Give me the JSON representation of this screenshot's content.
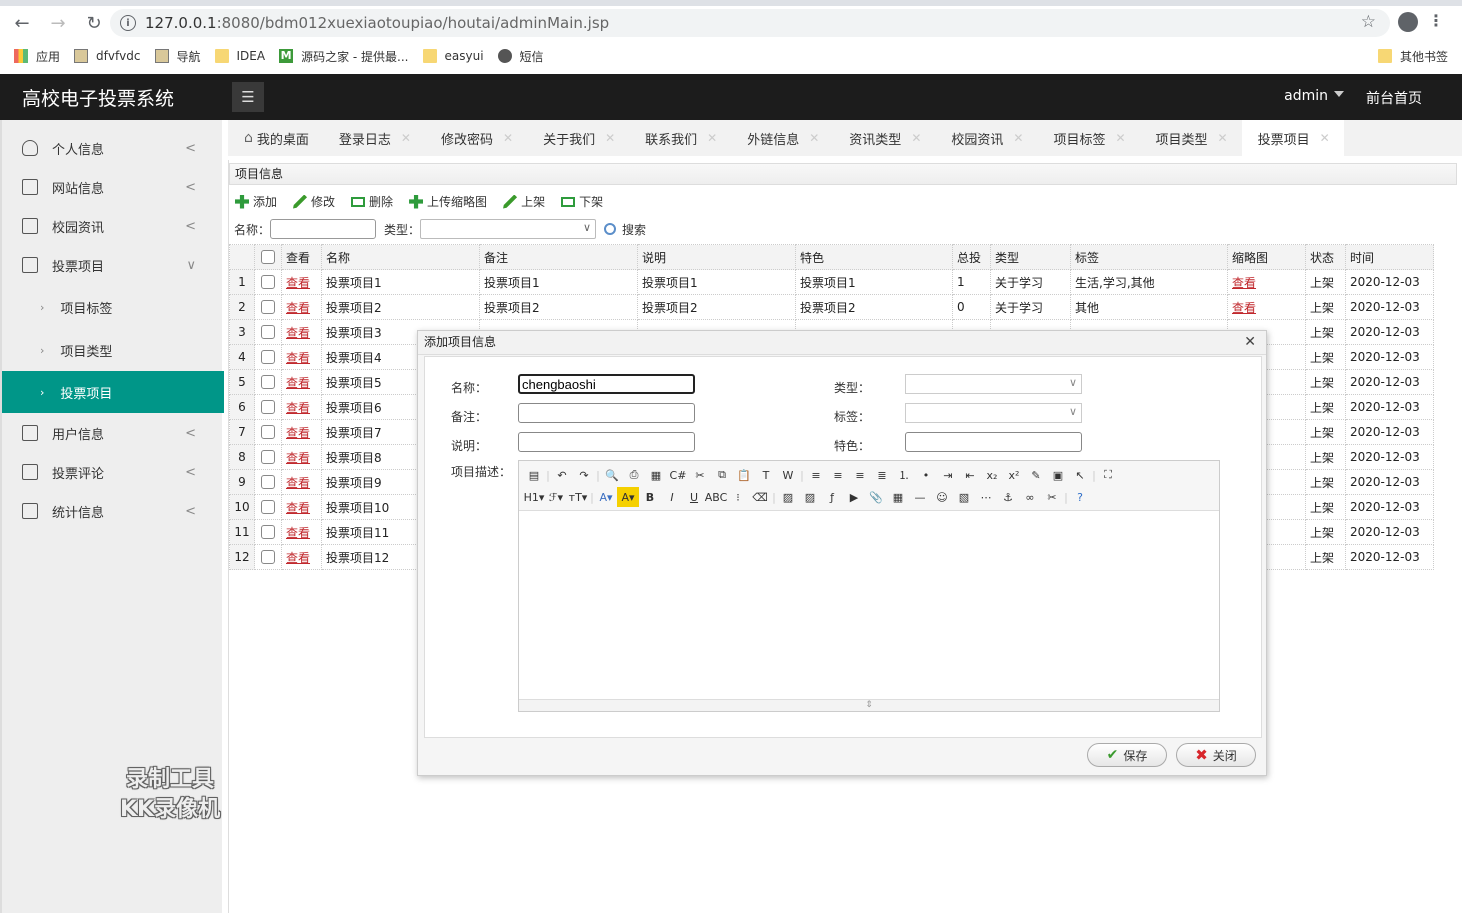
{
  "browser": {
    "url_host": "127.0.0.1",
    "url_rest": ":8080/bdm012xuexiaotoupiao/houtai/adminMain.jsp",
    "bookmarks": [
      {
        "label": "应用",
        "icon": "apps-grid-icon"
      },
      {
        "label": "dfvfvdc",
        "icon": "image-icon"
      },
      {
        "label": "导航",
        "icon": "image-icon"
      },
      {
        "label": "IDEA",
        "icon": "folder-icon"
      },
      {
        "label": "源码之家 - 提供最...",
        "icon": "m-logo-icon"
      },
      {
        "label": "easyui",
        "icon": "folder-icon"
      },
      {
        "label": "短信",
        "icon": "globe-icon"
      }
    ],
    "other_bookmarks": "其他书签"
  },
  "header": {
    "title": "高校电子投票系统",
    "user": "admin",
    "front_home": "前台首页"
  },
  "sidebar": {
    "items": [
      {
        "label": "个人信息",
        "icon": "user-icon",
        "arrow": "<"
      },
      {
        "label": "网站信息",
        "icon": "document-icon",
        "arrow": "<"
      },
      {
        "label": "校园资讯",
        "icon": "document-icon",
        "arrow": "<"
      },
      {
        "label": "投票项目",
        "icon": "document-icon",
        "arrow": "∨"
      },
      {
        "label": "用户信息",
        "icon": "document-icon",
        "arrow": "<"
      },
      {
        "label": "投票评论",
        "icon": "document-icon",
        "arrow": "<"
      },
      {
        "label": "统计信息",
        "icon": "document-icon",
        "arrow": "<"
      }
    ],
    "subitems": [
      {
        "label": "项目标签"
      },
      {
        "label": "项目类型"
      },
      {
        "label": "投票项目",
        "active": true
      }
    ]
  },
  "tabs": [
    {
      "label": "我的桌面",
      "closable": false
    },
    {
      "label": "登录日志",
      "closable": true
    },
    {
      "label": "修改密码",
      "closable": true
    },
    {
      "label": "关于我们",
      "closable": true
    },
    {
      "label": "联系我们",
      "closable": true
    },
    {
      "label": "外链信息",
      "closable": true
    },
    {
      "label": "资讯类型",
      "closable": true
    },
    {
      "label": "校园资讯",
      "closable": true
    },
    {
      "label": "项目标签",
      "closable": true
    },
    {
      "label": "项目类型",
      "closable": true
    },
    {
      "label": "投票项目",
      "closable": true,
      "active": true
    }
  ],
  "panel": {
    "title": "项目信息",
    "toolbar": {
      "add": "添加",
      "edit": "修改",
      "delete": "删除",
      "upload_thumb": "上传缩略图",
      "on_shelf": "上架",
      "off_shelf": "下架"
    },
    "search": {
      "name_label": "名称：",
      "name_value": "",
      "type_label": "类型：",
      "type_value": "",
      "button": "搜索"
    }
  },
  "table": {
    "columns": [
      "查看",
      "名称",
      "备注",
      "说明",
      "特色",
      "总投",
      "类型",
      "标签",
      "缩略图",
      "状态",
      "时间"
    ],
    "view_link": "查看",
    "rows": [
      {
        "n": "1",
        "name": "投票项目1",
        "remark": "投票项目1",
        "desc": "投票项目1",
        "feature": "投票项目1",
        "votes": "1",
        "type": "关于学习",
        "tags": "生活,学习,其他",
        "status": "上架",
        "time": "2020-12-03"
      },
      {
        "n": "2",
        "name": "投票项目2",
        "remark": "投票项目2",
        "desc": "投票项目2",
        "feature": "投票项目2",
        "votes": "0",
        "type": "关于学习",
        "tags": "其他",
        "status": "上架",
        "time": "2020-12-03"
      },
      {
        "n": "3",
        "name": "投票项目3",
        "status": "上架",
        "time": "2020-12-03"
      },
      {
        "n": "4",
        "name": "投票项目4",
        "status": "上架",
        "time": "2020-12-03"
      },
      {
        "n": "5",
        "name": "投票项目5",
        "status": "上架",
        "time": "2020-12-03"
      },
      {
        "n": "6",
        "name": "投票项目6",
        "status": "上架",
        "time": "2020-12-03"
      },
      {
        "n": "7",
        "name": "投票项目7",
        "status": "上架",
        "time": "2020-12-03"
      },
      {
        "n": "8",
        "name": "投票项目8",
        "status": "上架",
        "time": "2020-12-03"
      },
      {
        "n": "9",
        "name": "投票项目9",
        "status": "上架",
        "time": "2020-12-03"
      },
      {
        "n": "10",
        "name": "投票项目10",
        "status": "上架",
        "time": "2020-12-03"
      },
      {
        "n": "11",
        "name": "投票项目11",
        "status": "上架",
        "time": "2020-12-03"
      },
      {
        "n": "12",
        "name": "投票项目12",
        "status": "上架",
        "time": "2020-12-03"
      }
    ]
  },
  "dialog": {
    "title": "添加项目信息",
    "fields": {
      "name_label": "名称：",
      "name_value": "chengbaoshi",
      "remark_label": "备注：",
      "remark_value": "",
      "desc_label": "说明：",
      "desc_value": "",
      "type_label": "类型：",
      "type_value": "",
      "tag_label": "标签：",
      "tag_value": "",
      "feature_label": "特色：",
      "feature_value": "",
      "content_label": "项目描述："
    },
    "editor_toolbar_row1": [
      "source",
      "|",
      "undo",
      "redo",
      "|",
      "preview",
      "print",
      "template",
      "code",
      "cut",
      "copy",
      "paste",
      "paste-text",
      "paste-word",
      "|",
      "align-left",
      "align-center",
      "align-right",
      "justify",
      "ordered-list",
      "unordered-list",
      "indent",
      "outdent",
      "subscript",
      "superscript",
      "clear-format",
      "select-all",
      "select",
      "|",
      "fullscreen"
    ],
    "editor_toolbar_row2": [
      "H1",
      "font",
      "size",
      "|",
      "color",
      "highlight",
      "B",
      "I",
      "U",
      "ABC",
      "hr-line",
      "eraser",
      "|",
      "image",
      "multi-image",
      "flash",
      "media",
      "attach",
      "table",
      "hr",
      "emoticon",
      "map",
      "pagebreak",
      "anchor",
      "link",
      "unlink",
      "|",
      "help"
    ],
    "save": "保存",
    "close": "关闭"
  },
  "watermark": {
    "line1": "录制工具",
    "line2": "KK录像机"
  },
  "colors": {
    "accent": "#009688",
    "header_bg": "#1c1c1c",
    "link_red": "#c0282d"
  }
}
